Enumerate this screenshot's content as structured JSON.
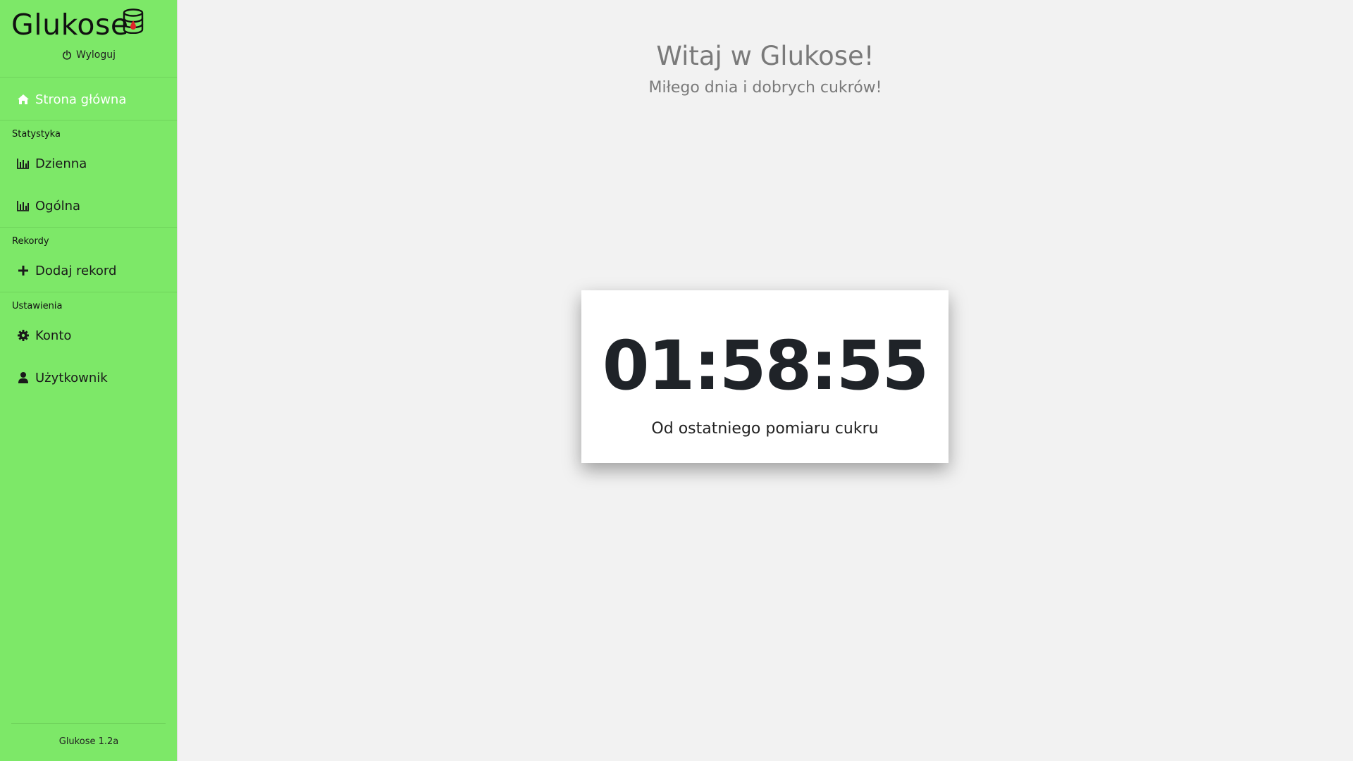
{
  "sidebar": {
    "brand": "Glukose",
    "logout_label": "Wyloguj",
    "home_label": "Strona główna",
    "sections": {
      "stats_label": "Statystyka",
      "records_label": "Rekordy",
      "settings_label": "Ustawienia"
    },
    "items": {
      "daily": "Dzienna",
      "general": "Ogólna",
      "add_record": "Dodaj rekord",
      "account": "Konto",
      "user": "Użytkownik"
    },
    "version": "Glukose 1.2a"
  },
  "main": {
    "welcome": "Witaj w Glukose!",
    "subtitle": "Miłego dnia i dobrych cukrów!",
    "timer": "01:58:55",
    "timer_caption": "Od ostatniego pomiaru cukru"
  },
  "colors": {
    "sidebar_bg": "#7de868",
    "background": "#f2f2f2",
    "card_bg": "#ffffff",
    "active_text": "#ffffff"
  }
}
